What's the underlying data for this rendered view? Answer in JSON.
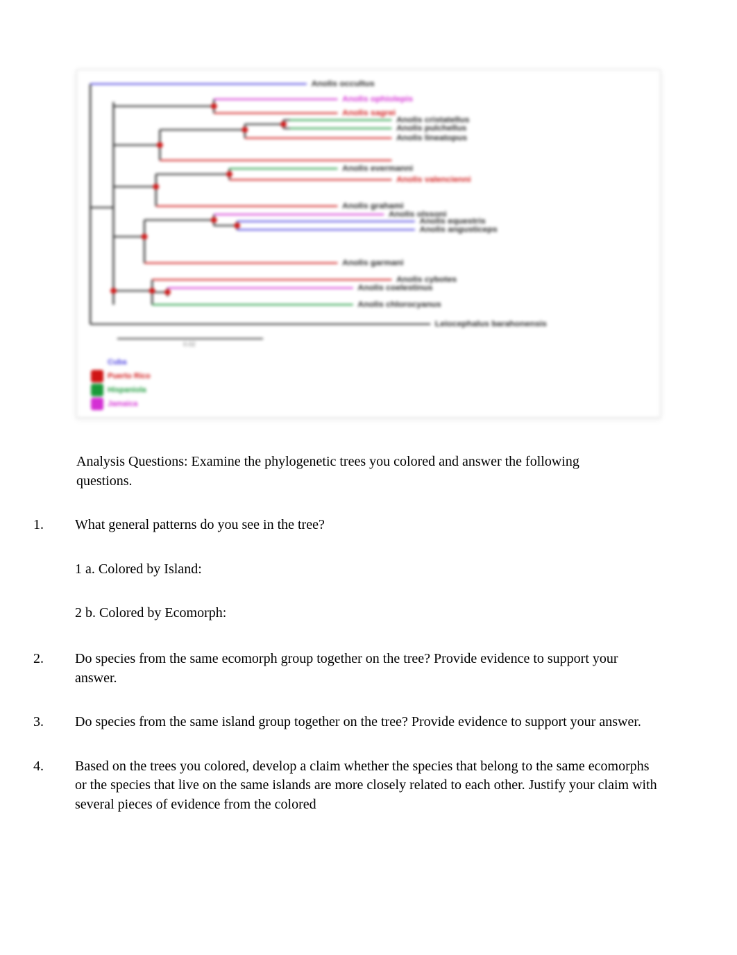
{
  "chart_data": {
    "type": "phylogenetic_tree",
    "outgroup": {
      "label": "Leiocephalus barahonensis",
      "color": "black"
    },
    "scale_label": "0.02",
    "taxa": [
      {
        "label": "Anolis occultus",
        "color": "blue",
        "yi": 0
      },
      {
        "label": "Anolis ophiolepis",
        "color": "magenta",
        "yi": 1
      },
      {
        "label": "Anolis sagrei",
        "color": "red",
        "yi": 2
      },
      {
        "label": "Anolis cristatellus",
        "color": "green",
        "yi": 3
      },
      {
        "label": "Anolis pulchellus",
        "color": "green",
        "yi": 4
      },
      {
        "label": "Anolis lineatopus",
        "color": "red",
        "yi": 5
      },
      {
        "label": "Anolis evermanni",
        "color": "green",
        "yi": 6
      },
      {
        "label": "Anolis valencienni",
        "color": "red",
        "yi": 7
      },
      {
        "label": "Anolis grahami",
        "color": "red",
        "yi": 8
      },
      {
        "label": "Anolis olssoni",
        "color": "magenta",
        "yi": 9
      },
      {
        "label": "Anolis equestris",
        "color": "blue",
        "yi": 10
      },
      {
        "label": "Anolis angusticeps",
        "color": "blue",
        "yi": 11
      },
      {
        "label": "Anolis garmani",
        "color": "red",
        "yi": 12
      },
      {
        "label": "Anolis cybotes",
        "color": "red",
        "yi": 13
      },
      {
        "label": "Anolis coelestinus",
        "color": "magenta",
        "yi": 14
      },
      {
        "label": "Anolis chlorocyanus",
        "color": "green",
        "yi": 15
      }
    ],
    "legend": [
      {
        "label": "Cuba",
        "color": "blue"
      },
      {
        "label": "Puerto Rico",
        "color": "red"
      },
      {
        "label": "Hispaniola",
        "color": "green"
      },
      {
        "label": "Jamaica",
        "color": "magenta"
      }
    ]
  },
  "colors": {
    "blue": "#4a3fe0",
    "red": "#d01515",
    "green": "#1a9a3a",
    "magenta": "#d42fd4",
    "black": "#222222"
  },
  "intro": "Analysis Questions:   Examine the phylogenetic trees you colored and answer the following questions.",
  "questions": {
    "q1": {
      "num": "1.",
      "text": "What general patterns do you see in the tree?",
      "subs": {
        "a": "1 a. Colored by Island:",
        "b": "2 b. Colored by Ecomorph:"
      }
    },
    "q2": {
      "num": "2.",
      "text": "Do species from the same ecomorph group together on the tree? Provide evidence to support your answer."
    },
    "q3": {
      "num": "3.",
      "text": "Do species from the same island group together on the tree? Provide evidence to support your answer."
    },
    "q4": {
      "num": "4.",
      "text": "Based on the trees you colored, develop a claim whether the species that belong to the same ecomorphs or the species that live on the same islands are more closely related to each other. Justify your claim with several pieces of evidence from the colored"
    }
  }
}
